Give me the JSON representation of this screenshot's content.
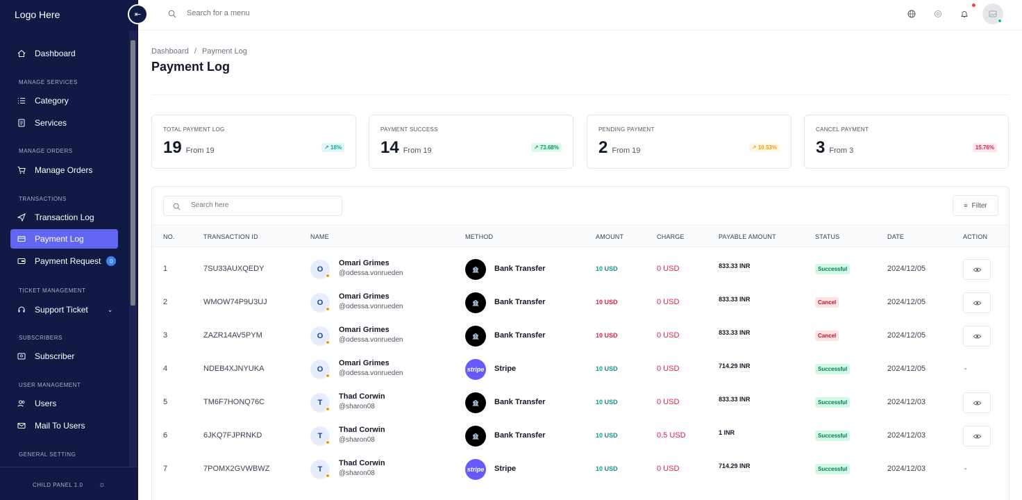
{
  "app": {
    "logo": "Logo Here",
    "version": "CHILD PANEL 1.0"
  },
  "topbar": {
    "search_placeholder": "Search for a menu"
  },
  "sidebar": {
    "items": [
      {
        "label": "Dashboard",
        "icon": "home-icon"
      },
      {
        "section": "MANAGE SERVICES"
      },
      {
        "label": "Category",
        "icon": "list-icon"
      },
      {
        "label": "Services",
        "icon": "document-icon"
      },
      {
        "section": "MANAGE ORDERS"
      },
      {
        "label": "Manage Orders",
        "icon": "cart-icon"
      },
      {
        "section": "TRANSACTIONS"
      },
      {
        "label": "Transaction Log",
        "icon": "send-icon"
      },
      {
        "label": "Payment Log",
        "icon": "card-icon",
        "active": true
      },
      {
        "label": "Payment Request",
        "icon": "wallet-icon",
        "badge": "0"
      },
      {
        "section": "TICKET MANAGEMENT"
      },
      {
        "label": "Support Ticket",
        "icon": "headset-icon"
      },
      {
        "section": "SUBSCRIBERS"
      },
      {
        "label": "Subscriber",
        "icon": "subscriber-icon"
      },
      {
        "section": "USER MANAGEMENT"
      },
      {
        "label": "Users",
        "icon": "users-icon"
      },
      {
        "label": "Mail To Users",
        "icon": "mail-icon"
      },
      {
        "section": "GENERAL SETTING"
      }
    ]
  },
  "page": {
    "breadcrumb": [
      "Dashboard",
      "/",
      "Payment Log"
    ],
    "title": "Payment Log"
  },
  "stats": [
    {
      "label": "TOTAL PAYMENT LOG",
      "value": "19",
      "from": "From 19",
      "pill": "18%",
      "pill_color": "#0ea5a4",
      "pill_bg": "#e0f7f5"
    },
    {
      "label": "PAYMENT SUCCESS",
      "value": "14",
      "from": "From 19",
      "pill": "73.68%",
      "pill_color": "#059669",
      "pill_bg": "#dcfce7"
    },
    {
      "label": "PENDING PAYMENT",
      "value": "2",
      "from": "From 19",
      "pill": "10.53%",
      "pill_color": "#f59e0b",
      "pill_bg": "#fff7e6"
    },
    {
      "label": "CANCEL PAYMENT",
      "value": "3",
      "from": "From 3",
      "pill": "15.76%",
      "pill_color": "#e11d48",
      "pill_bg": "#fde7ec"
    }
  ],
  "table": {
    "search_placeholder": "Search here",
    "filter_label": "Filter",
    "columns": [
      "NO.",
      "TRANSACTION ID",
      "NAME",
      "METHOD",
      "AMOUNT",
      "CHARGE",
      "PAYABLE AMOUNT",
      "STATUS",
      "DATE",
      "ACTION"
    ],
    "rows": [
      {
        "no": "1",
        "txn": "7SU33AUXQEDY",
        "initial": "O",
        "name": "Omari Grimes",
        "user": "@odessa.vonrueden",
        "method": "Bank Transfer",
        "method_type": "bank",
        "amount": "10 USD",
        "amount_color": "#0d9488",
        "charge": "0 USD",
        "payable": "833.33 INR",
        "status": "Successful",
        "status_type": "ok",
        "date": "2024/12/05",
        "action": "view"
      },
      {
        "no": "2",
        "txn": "WMOW74P9U3UJ",
        "initial": "O",
        "name": "Omari Grimes",
        "user": "@odessa.vonrueden",
        "method": "Bank Transfer",
        "method_type": "bank",
        "amount": "10 USD",
        "amount_color": "#e11d48",
        "charge": "0 USD",
        "payable": "833.33 INR",
        "status": "Cancel",
        "status_type": "cancel",
        "date": "2024/12/05",
        "action": "view"
      },
      {
        "no": "3",
        "txn": "ZAZR14AV5PYM",
        "initial": "O",
        "name": "Omari Grimes",
        "user": "@odessa.vonrueden",
        "method": "Bank Transfer",
        "method_type": "bank",
        "amount": "10 USD",
        "amount_color": "#e11d48",
        "charge": "0 USD",
        "payable": "833.33 INR",
        "status": "Cancel",
        "status_type": "cancel",
        "date": "2024/12/05",
        "action": "view"
      },
      {
        "no": "4",
        "txn": "NDEB4XJNYUKA",
        "initial": "O",
        "name": "Omari Grimes",
        "user": "@odessa.vonrueden",
        "method": "Stripe",
        "method_type": "stripe",
        "amount": "10 USD",
        "amount_color": "#0d9488",
        "charge": "0 USD",
        "payable": "714.29 INR",
        "status": "Successful",
        "status_type": "ok",
        "date": "2024/12/05",
        "action": "-"
      },
      {
        "no": "5",
        "txn": "TM6F7HONQ76C",
        "initial": "T",
        "name": "Thad Corwin",
        "user": "@sharon08",
        "method": "Bank Transfer",
        "method_type": "bank",
        "amount": "10 USD",
        "amount_color": "#0d9488",
        "charge": "0 USD",
        "payable": "833.33 INR",
        "status": "Successful",
        "status_type": "ok",
        "date": "2024/12/03",
        "action": "view"
      },
      {
        "no": "6",
        "txn": "6JKQ7FJPRNKD",
        "initial": "T",
        "name": "Thad Corwin",
        "user": "@sharon08",
        "method": "Bank Transfer",
        "method_type": "bank",
        "amount": "10 USD",
        "amount_color": "#0d9488",
        "charge": "0.5 USD",
        "payable": "1 INR",
        "status": "Successful",
        "status_type": "ok",
        "date": "2024/12/03",
        "action": "view"
      },
      {
        "no": "7",
        "txn": "7POMX2GVWBWZ",
        "initial": "T",
        "name": "Thad Corwin",
        "user": "@sharon08",
        "method": "Stripe",
        "method_type": "stripe",
        "amount": "10 USD",
        "amount_color": "#0d9488",
        "charge": "0 USD",
        "payable": "714.29 INR",
        "status": "Successful",
        "status_type": "ok",
        "date": "2024/12/03",
        "action": "-"
      }
    ]
  }
}
